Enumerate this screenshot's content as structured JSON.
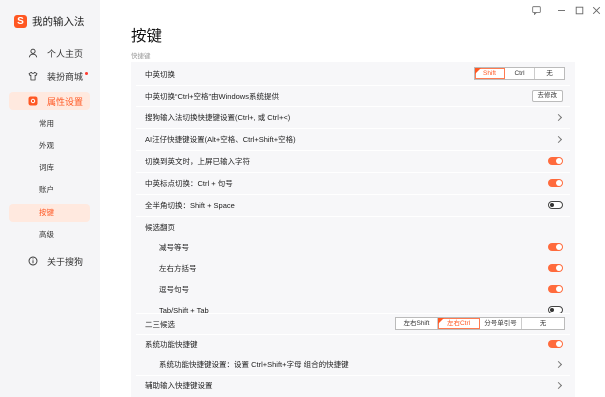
{
  "app": {
    "logo_char": "S",
    "name": "我的输入法"
  },
  "window": {
    "icons": [
      "feedback-icon",
      "minimize-icon",
      "maximize-icon",
      "close-icon"
    ]
  },
  "sidebar": {
    "items": [
      {
        "label": "个人主页",
        "icon": "person-icon"
      },
      {
        "label": "装扮商城",
        "icon": "shirt-icon",
        "badge": "dot"
      },
      {
        "label": "属性设置",
        "icon": "settings-icon",
        "active": true
      },
      {
        "label": "关于搜狗",
        "icon": "info-icon"
      }
    ],
    "sub_items": [
      {
        "label": "常用"
      },
      {
        "label": "外观"
      },
      {
        "label": "词库"
      },
      {
        "label": "账户"
      },
      {
        "label": "按键",
        "active": true
      },
      {
        "label": "高级"
      }
    ]
  },
  "page": {
    "title": "按键",
    "section": "快捷键"
  },
  "rows": {
    "r0": {
      "label": "中英切换",
      "options": [
        "Shift",
        "Ctrl",
        "无"
      ],
      "selected": "Shift"
    },
    "r1": {
      "label": "中英切换“Ctrl+空格”由Windows系统提供",
      "button": "去修改"
    },
    "r2": {
      "label": "搜狗输入法切换快捷键设置(Ctrl+, 或 Ctrl+<)"
    },
    "r3": {
      "label": "AI汪仔快捷键设置(Alt+空格、Ctrl+Shift+空格)"
    },
    "r4": {
      "label": "切换到英文时，上屏已输入字符",
      "on": true
    },
    "r5": {
      "label": "中英标点切换：Ctrl + 句号",
      "on": true
    },
    "r6": {
      "label": "全半角切换：Shift + Space",
      "on": false
    },
    "r7": {
      "label": "候选翻页"
    },
    "r8": {
      "label": "减号等号",
      "on": true
    },
    "r9": {
      "label": "左右方括号",
      "on": true
    },
    "r10": {
      "label": "逗号句号",
      "on": true
    },
    "r11": {
      "label": "Tab/Shift + Tab",
      "on": false
    },
    "r12": {
      "label": "二三候选",
      "options": [
        "左右Shift",
        "左右Ctrl",
        "分号单引号",
        "无"
      ],
      "selected": "左右Ctrl"
    },
    "r13": {
      "label": "系统功能快捷键",
      "on": true
    },
    "r14": {
      "label": "系统功能快捷键设置：设置 Ctrl+Shift+字母 组合的快捷键"
    },
    "r15": {
      "label": "辅助输入快捷键设置"
    }
  },
  "colors": {
    "accent": "#ff5722",
    "toggle_on": "#ff6b3d"
  }
}
